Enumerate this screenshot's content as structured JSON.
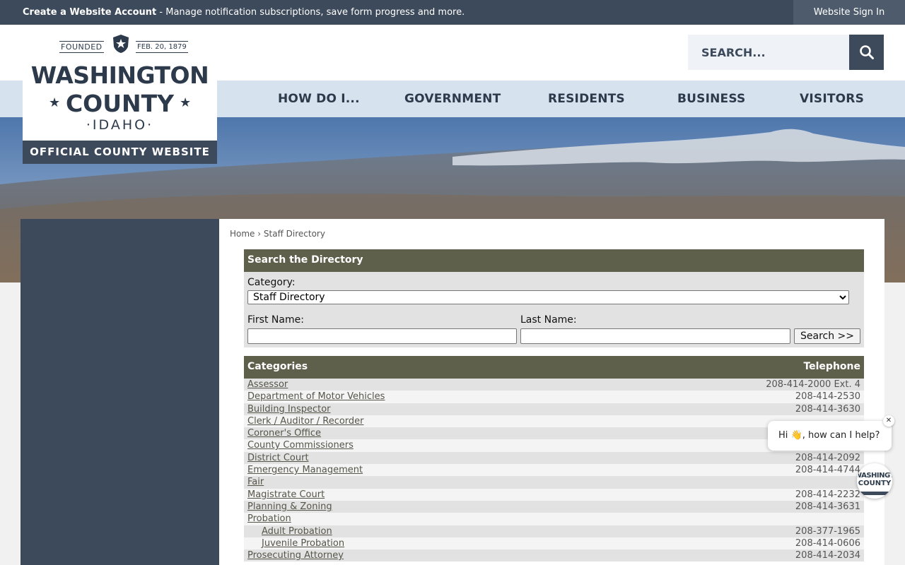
{
  "topbar": {
    "account_link": "Create a Website Account",
    "account_desc": " - Manage notification subscriptions, save form progress and more.",
    "sign_in": "Website Sign In"
  },
  "logo": {
    "founded": "FOUNDED",
    "date": "FEB. 20, 1879",
    "line1": "WASHINGTON",
    "line2": "COUNTY",
    "state": "·IDAHO·",
    "tagline": "OFFICIAL COUNTY WEBSITE"
  },
  "search": {
    "placeholder": "SEARCH..."
  },
  "nav": [
    "HOW DO I...",
    "GOVERNMENT",
    "RESIDENTS",
    "BUSINESS",
    "VISITORS"
  ],
  "breadcrumb": {
    "home": "Home",
    "sep": "›",
    "current": "Staff Directory"
  },
  "directory": {
    "title": "Search the Directory",
    "category_label": "Category:",
    "category_value": "Staff Directory",
    "first_label": "First Name:",
    "last_label": "Last Name:",
    "button": "Search >>"
  },
  "categories": {
    "header_left": "Categories",
    "header_right": "Telephone",
    "rows": [
      {
        "name": "Assessor",
        "tel": "208-414-2000 Ext. 4"
      },
      {
        "name": "Department of Motor Vehicles",
        "tel": "208-414-2530"
      },
      {
        "name": "Building Inspector",
        "tel": "208-414-3630"
      },
      {
        "name": "Clerk / Auditor / Recorder",
        "tel": ""
      },
      {
        "name": "Coroner's Office",
        "tel": ""
      },
      {
        "name": "County Commissioners",
        "tel": ""
      },
      {
        "name": "District Court",
        "tel": "208-414-2092"
      },
      {
        "name": "Emergency Management",
        "tel": "208-414-4744"
      },
      {
        "name": "Fair",
        "tel": ""
      },
      {
        "name": "Magistrate Court",
        "tel": "208-414-2232"
      },
      {
        "name": "Planning & Zoning",
        "tel": "208-414-3631"
      },
      {
        "name": "Probation",
        "tel": ""
      },
      {
        "name": "Adult Probation",
        "tel": "208-377-1965",
        "sub": true
      },
      {
        "name": "Juvenile Probation",
        "tel": "208-414-0606",
        "sub": true
      },
      {
        "name": "Prosecuting Attorney",
        "tel": "208-414-2034"
      }
    ]
  },
  "chat": {
    "greeting": "Hi 👋, how can I help?",
    "close": "✕",
    "avatar_line1": "WASHINGTON",
    "avatar_line2": "COUNTY"
  }
}
